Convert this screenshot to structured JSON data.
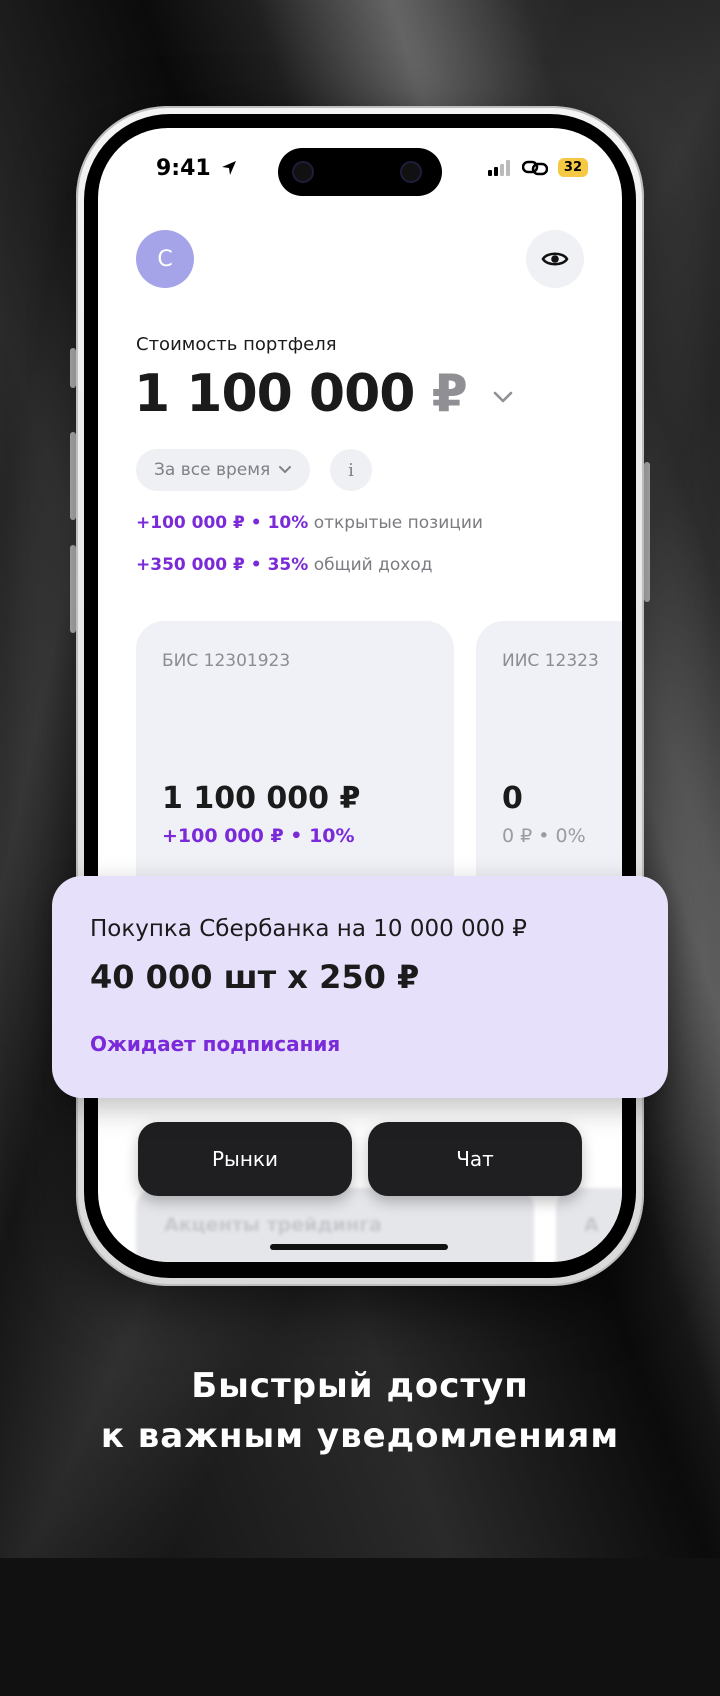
{
  "status_bar": {
    "time": "9:41",
    "battery": "32"
  },
  "header": {
    "avatar_letter": "С"
  },
  "portfolio": {
    "label": "Стоимость портфеля",
    "value": "1 100 000",
    "currency": "₽",
    "period": "За все время",
    "info": "i",
    "open_positions": {
      "amount": "+100 000 ₽ • 10%",
      "label": "открытые позиции"
    },
    "total_income": {
      "amount": "+350 000 ₽ • 35%",
      "label": "общий доход"
    }
  },
  "accounts": [
    {
      "name": "БИС 12301923",
      "value": "1 100 000 ₽",
      "delta": "+100 000 ₽ • 10%",
      "delta_color": "#7a2ad8"
    },
    {
      "name": "ИИС 12323",
      "value": "0",
      "delta": "0 ₽ • 0%",
      "delta_color": "#9a9ba3"
    }
  ],
  "actions": {
    "markets": "Рынки",
    "chat": "Чат"
  },
  "feed": {
    "item1": "Акценты трейдинга",
    "item2": "А"
  },
  "notification": {
    "title": "Покупка Сбербанка на 10 000 000 ₽",
    "amount": "40 000 шт х 250 ₽",
    "status": "Ожидает подписания"
  },
  "caption": {
    "line1": "Быстрый доступ",
    "line2": "к важным уведомлениям"
  },
  "colors": {
    "accent": "#7a2ad8",
    "notification_bg": "#e6e0fb",
    "avatar": "#a6a4e8"
  }
}
